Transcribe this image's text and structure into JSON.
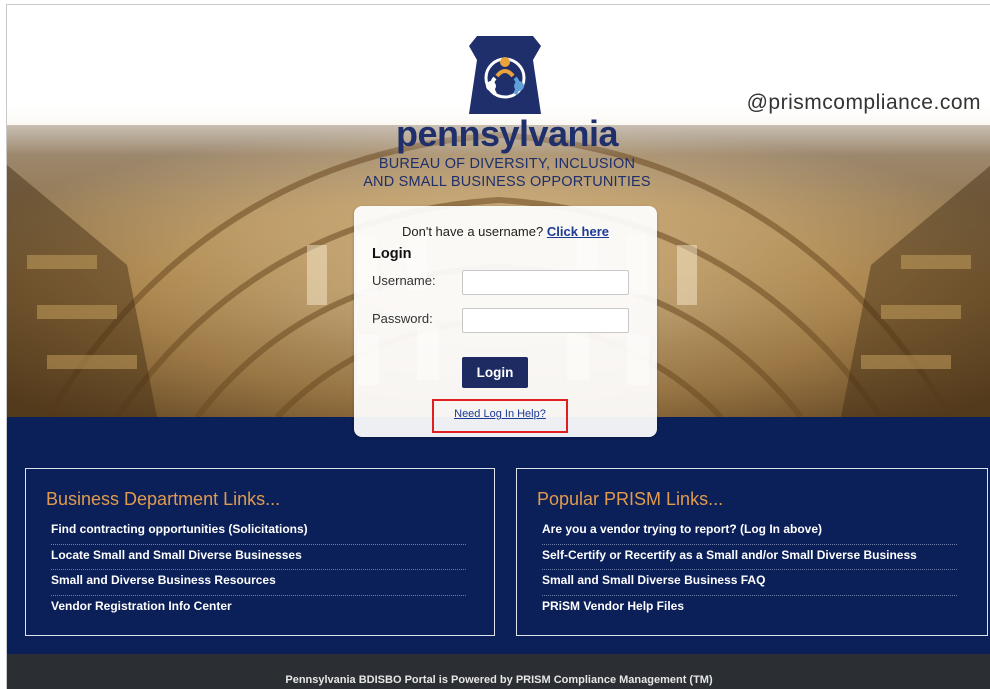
{
  "header": {
    "domain_text": "@prismcompliance.com",
    "brand_name": "pennsylvania",
    "brand_sub_line1": "BUREAU OF DIVERSITY, INCLUSION",
    "brand_sub_line2": "AND SMALL BUSINESS OPPORTUNITIES"
  },
  "login": {
    "signup_prompt": "Don't have a username?",
    "signup_link": "Click here",
    "title": "Login",
    "username_label": "Username:",
    "password_label": "Password:",
    "username_value": "",
    "password_value": "",
    "submit_label": "Login",
    "help_link": "Need Log In Help?"
  },
  "business_links": {
    "title": "Business Department Links...",
    "items": [
      "Find contracting opportunities (Solicitations)",
      "Locate Small and Small Diverse Businesses",
      "Small and Diverse Business Resources",
      "Vendor Registration Info Center"
    ]
  },
  "prism_links": {
    "title": "Popular PRISM Links...",
    "items": [
      "Are you a vendor trying to report? (Log In above)",
      "Self-Certify or Recertify as a Small and/or Small Diverse Business",
      "Small and Small Diverse Business FAQ",
      "PRiSM Vendor Help Files"
    ]
  },
  "footer": {
    "text": "Pennsylvania BDISBO Portal is Powered by PRISM Compliance Management (TM)"
  },
  "colors": {
    "navy": "#0b1f58",
    "brand": "#1f2f6b",
    "accent": "#e19b4e",
    "highlight": "#e02020",
    "footer": "#2b2e32"
  },
  "icons": {
    "logo": "keystone-people-logo-icon"
  }
}
